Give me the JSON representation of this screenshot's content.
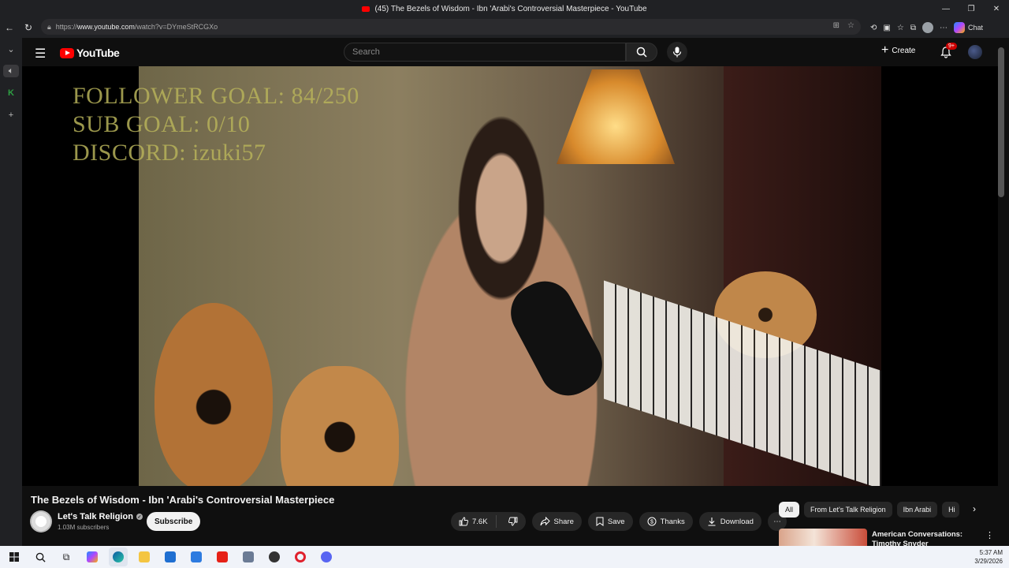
{
  "browser": {
    "window_title": "(45) The Bezels of Wisdom - Ibn 'Arabi's Controversial Masterpiece - YouTube",
    "url_prefix": "https://",
    "url_host": "www.youtube.com",
    "url_path": "/watch?v=DYmeStRCGXo",
    "chat_label": "Chat"
  },
  "youtube_header": {
    "logo_text": "YouTube",
    "search_placeholder": "Search",
    "create_label": "Create",
    "notification_count": "9+"
  },
  "video_overlay": {
    "lines": [
      "FOLLOWER GOAL:  84/250",
      "SUB GOAL: 0/10",
      "DISCORD: izuki57"
    ]
  },
  "video_info": {
    "title": "The Bezels of Wisdom - Ibn 'Arabi's Controversial Masterpiece",
    "channel_name": "Let's Talk Religion",
    "subscribers": "1.03M subscribers",
    "subscribe_label": "Subscribe",
    "like_count": "7.6K",
    "share_label": "Share",
    "save_label": "Save",
    "thanks_label": "Thanks",
    "download_label": "Download"
  },
  "chips": [
    "All",
    "From Let's Talk Religion",
    "Ibn Arabi",
    "Hi"
  ],
  "recommendation": {
    "title": "American Conversations: Timothy Snyder"
  },
  "taskbar": {
    "time": "5:37 AM",
    "date": "3/29/2026"
  },
  "colors": {
    "youtube_red": "#ff0000",
    "background": "#0f0f0f",
    "overlay_text": "#b7b25a"
  }
}
